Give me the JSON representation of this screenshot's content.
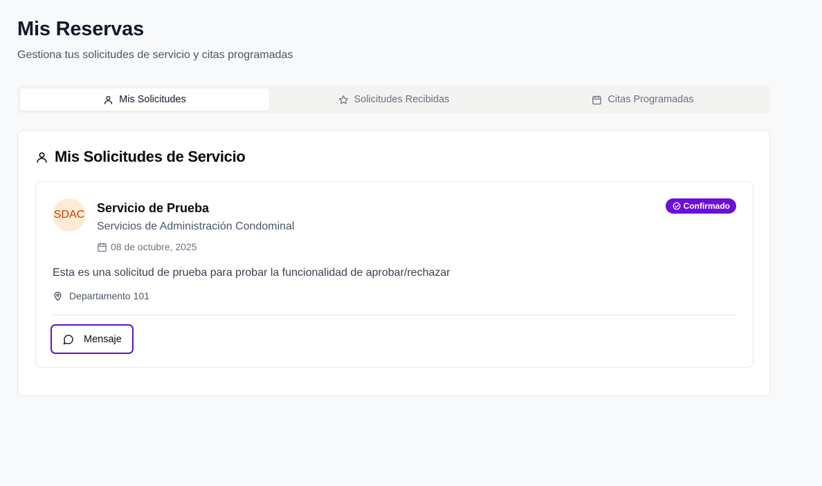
{
  "page": {
    "title": "Mis Reservas",
    "subtitle": "Gestiona tus solicitudes de servicio y citas programadas"
  },
  "tabs": [
    {
      "label": "Mis Solicitudes",
      "icon": "user-icon",
      "active": true
    },
    {
      "label": "Solicitudes Recibidas",
      "icon": "star-icon",
      "active": false
    },
    {
      "label": "Citas Programadas",
      "icon": "calendar-icon",
      "active": false
    }
  ],
  "section": {
    "title": "Mis Solicitudes de Servicio",
    "icon": "user-icon"
  },
  "request": {
    "avatar_text": "SDAC",
    "service_name": "Servicio de Prueba",
    "provider": "Servicios de Administración Condominal",
    "date": "08 de octubre, 2025",
    "status": "Confirmado",
    "description": "Esta es una solicitud de prueba para probar la funcionalidad de aprobar/rechazar",
    "location": "Departamento 101",
    "message_button": "Mensaje"
  },
  "colors": {
    "accent": "#6b0fd9",
    "button_border": "#5b13c9",
    "avatar_bg": "#fdebd3",
    "avatar_text": "#c2410c"
  }
}
